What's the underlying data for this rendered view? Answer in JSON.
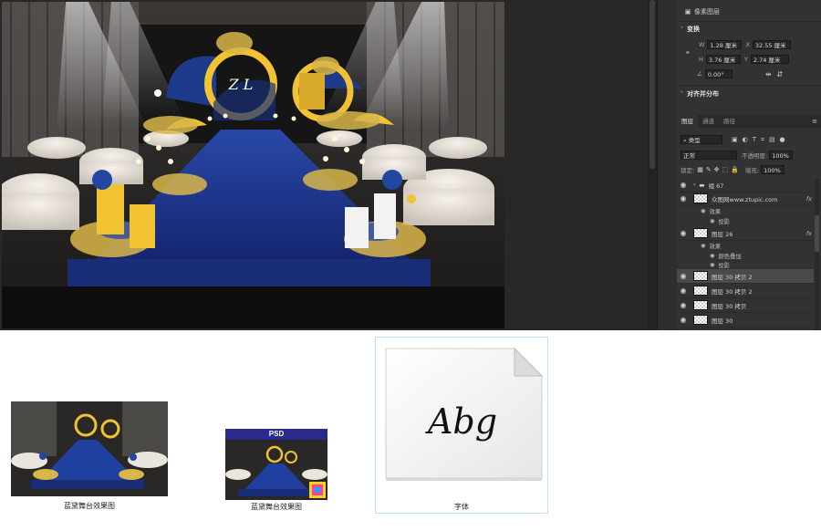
{
  "properties_panel": {
    "header": "像素图层",
    "transform_title": "变换",
    "w_label": "W",
    "w_value": "1.28 厘米",
    "x_label": "X",
    "x_value": "32.55 厘米",
    "h_label": "H",
    "h_value": "3.76 厘米",
    "y_label": "Y",
    "y_value": "2.74 厘米",
    "angle_value": "0.00°",
    "align_title": "对齐并分布"
  },
  "layers_panel": {
    "tabs": [
      "图层",
      "通道",
      "路径"
    ],
    "filter_label": "类型",
    "blend_mode": "正常",
    "opacity_label": "不透明度:",
    "opacity_value": "100%",
    "lock_label": "锁定:",
    "fill_label": "填充:",
    "fill_value": "100%",
    "layers": [
      {
        "name": "组 67"
      },
      {
        "name": "众图网www.ztupic.com",
        "fx": "fx"
      },
      {
        "name": "效果"
      },
      {
        "name": "投影"
      },
      {
        "name": "图层 26",
        "fx": "fx"
      },
      {
        "name": "效果"
      },
      {
        "name": "颜色叠加"
      },
      {
        "name": "投影"
      },
      {
        "name": "图层 30 拷贝 2"
      },
      {
        "name": "图层 30 拷贝 2"
      },
      {
        "name": "图层 30 拷贝"
      },
      {
        "name": "图层 30"
      }
    ]
  },
  "files": [
    {
      "caption": "蓝黛舞台效果图"
    },
    {
      "caption": "蓝黛舞台效果图",
      "badge": "PSD"
    },
    {
      "caption": "字体",
      "preview_text": "Abg"
    }
  ],
  "scene": {
    "monogram": "Z L"
  },
  "colors": {
    "ps_bg": "#282828",
    "panel_bg": "#323232",
    "stage_blue": "#1f3a8a",
    "accent_yellow": "#f1c232",
    "selection_border": "#bfe0f5"
  }
}
